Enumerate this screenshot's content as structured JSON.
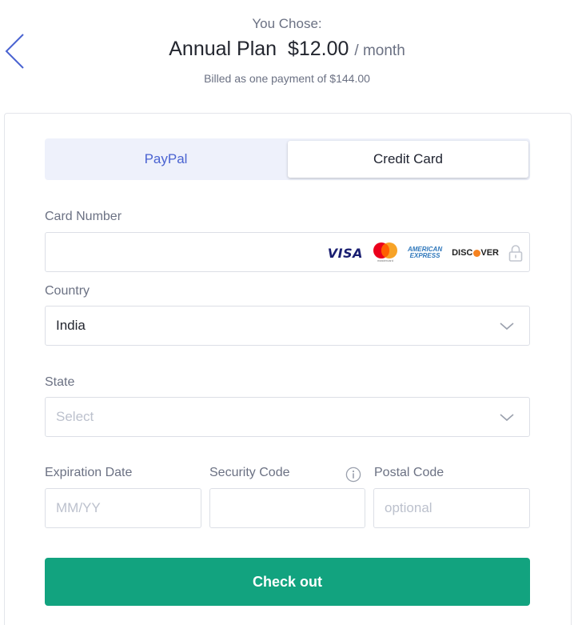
{
  "summary": {
    "you_chose": "You Chose:",
    "plan_name": "Annual Plan",
    "price": "$12.00",
    "per": "/ month",
    "billed": "Billed as one payment of $144.00"
  },
  "tabs": {
    "paypal": "PayPal",
    "credit_card": "Credit Card",
    "active": "Credit Card"
  },
  "form": {
    "card_number": {
      "label": "Card Number",
      "value": ""
    },
    "card_brands": {
      "visa": "VISA",
      "mastercard": "mastercard",
      "amex_line1": "AMERICAN",
      "amex_line2": "EXPRESS",
      "discover_a": "DISC",
      "discover_b": "VER"
    },
    "country": {
      "label": "Country",
      "value": "India"
    },
    "state": {
      "label": "State",
      "placeholder": "Select"
    },
    "expiration": {
      "label": "Expiration Date",
      "placeholder": "MM/YY"
    },
    "security": {
      "label": "Security Code",
      "value": ""
    },
    "postal": {
      "label": "Postal Code",
      "placeholder": "optional"
    }
  },
  "checkout": {
    "label": "Check out"
  },
  "colors": {
    "accent": "#12a37f",
    "tab_link": "#4a63d1",
    "tab_bg": "#eef1fb",
    "label": "#6b7183",
    "placeholder": "#bcc1cd"
  },
  "icons": [
    "chevron-left-icon",
    "chevron-down-icon",
    "lock-icon",
    "info-icon"
  ]
}
